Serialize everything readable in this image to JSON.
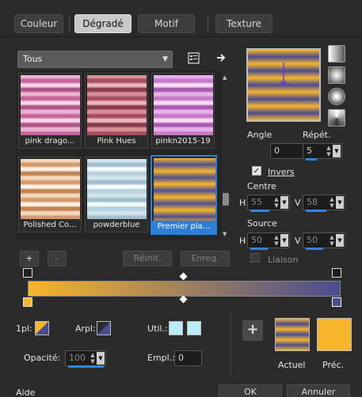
{
  "tabs": [
    {
      "label": "Couleur",
      "active": false
    },
    {
      "label": "Dégradé",
      "active": true
    },
    {
      "label": "Motif",
      "active": false
    },
    {
      "label": "Texture",
      "active": false
    }
  ],
  "category": {
    "value": "Tous"
  },
  "gallery": [
    {
      "label": "pink drago...",
      "colors": [
        "#e8b4cf",
        "#c8639c",
        "#f5d6e6",
        "#b05488"
      ]
    },
    {
      "label": "Pink Hues",
      "colors": [
        "#d68e98",
        "#a84d5b",
        "#e8b7bd",
        "#8a3b49"
      ]
    },
    {
      "label": "pinkn2015-19",
      "colors": [
        "#e7b0e8",
        "#c779c6",
        "#f7dcf4",
        "#a85bb0"
      ]
    },
    {
      "label": "Polished Co...",
      "colors": [
        "#f4d8bd",
        "#d79a6c",
        "#fff1e3",
        "#c28355"
      ]
    },
    {
      "label": "powderblue",
      "colors": [
        "#d4e4ec",
        "#9fbfcf",
        "#f4f9fb",
        "#b7d1de"
      ]
    },
    {
      "label": "Premier pla...",
      "colors": [
        "#f7b52b",
        "#4f4f8f",
        "#f2c24a",
        "#3a3d7c"
      ],
      "selected": true
    }
  ],
  "buttons": {
    "add": "+",
    "remove": "-",
    "reset": "Réinit.",
    "save": "Enreg.",
    "ok": "OK",
    "cancel": "Annuler",
    "help": "Aide",
    "add_swatch": "+"
  },
  "angle": {
    "label": "Angle",
    "value": "0"
  },
  "repeat": {
    "label": "Répét.",
    "value": "5"
  },
  "invert": {
    "label": "Invers",
    "checked": true
  },
  "centre": {
    "label": "Centre",
    "h_label": "H",
    "h": "55",
    "v_label": "V",
    "v": "58"
  },
  "source": {
    "label": "Source",
    "h_label": "H",
    "h": "50",
    "v_label": "V",
    "v": "50"
  },
  "link": {
    "label": "Liaison",
    "checked": false
  },
  "stops": {
    "first_label": "1pl:",
    "bg_label": "Arpl:",
    "util_label": "Util.:",
    "opacity_label": "Opacité:",
    "opacity_value": "100",
    "location_label": "Empl.:",
    "location_value": "0"
  },
  "swatches": {
    "current_label": "Actuel",
    "previous_label": "Préc."
  },
  "colors": {
    "accent": "#2d7ed6",
    "gradient_start": "#f7b52b",
    "gradient_end": "#4a4c8f",
    "util_swatch": "#b9ecf7",
    "prev_swatch": "#f7b52b"
  }
}
